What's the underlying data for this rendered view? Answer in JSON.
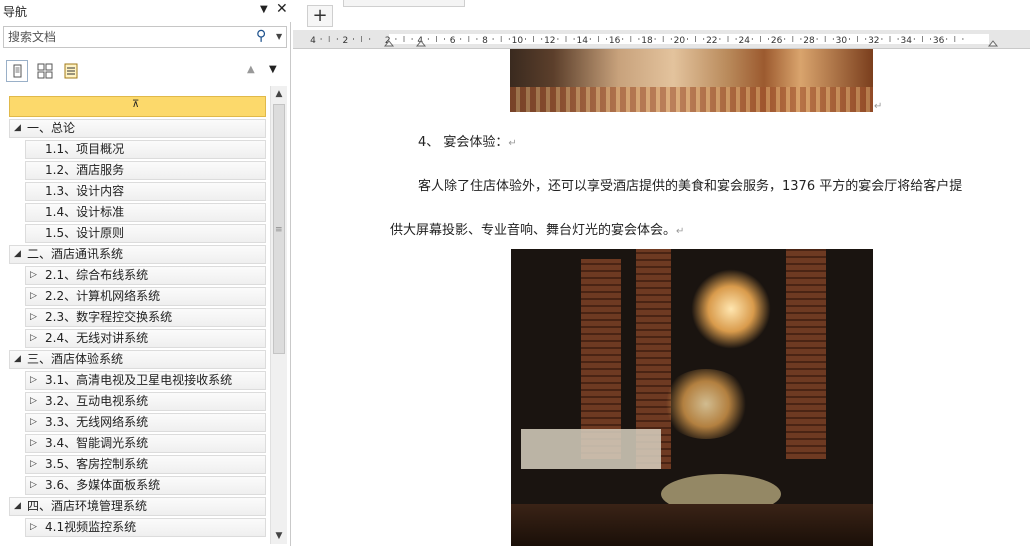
{
  "nav": {
    "title": "导航",
    "search_placeholder": "搜索文档",
    "icons": {
      "dropdown": "triangle-down-icon",
      "close": "close-icon",
      "search": "magnifier-icon"
    },
    "tree": [
      {
        "label": "一、总论",
        "level": 1,
        "expanded": true
      },
      {
        "label": "1.1、项目概况",
        "level": 2
      },
      {
        "label": "1.2、酒店服务",
        "level": 2
      },
      {
        "label": "1.3、设计内容",
        "level": 2
      },
      {
        "label": "1.4、设计标准",
        "level": 2
      },
      {
        "label": "1.5、设计原则",
        "level": 2
      },
      {
        "label": "二、酒店通讯系统",
        "level": 1,
        "expanded": true
      },
      {
        "label": "2.1、综合布线系统",
        "level": 2,
        "collapsed": true
      },
      {
        "label": "2.2、计算机网络系统",
        "level": 2,
        "collapsed": true
      },
      {
        "label": "2.3、数字程控交换系统",
        "level": 2,
        "collapsed": true
      },
      {
        "label": "2.4、无线对讲系统",
        "level": 2,
        "collapsed": true
      },
      {
        "label": "三、酒店体验系统",
        "level": 1,
        "expanded": true
      },
      {
        "label": "3.1、高清电视及卫星电视接收系统",
        "level": 2,
        "collapsed": true
      },
      {
        "label": "3.2、互动电视系统",
        "level": 2,
        "collapsed": true
      },
      {
        "label": "3.3、无线网络系统",
        "level": 2,
        "collapsed": true
      },
      {
        "label": "3.4、智能调光系统",
        "level": 2,
        "collapsed": true
      },
      {
        "label": "3.5、客房控制系统",
        "level": 2,
        "collapsed": true
      },
      {
        "label": "3.6、多媒体面板系统",
        "level": 2,
        "collapsed": true
      },
      {
        "label": "四、酒店环境管理系统",
        "level": 1,
        "expanded": true
      },
      {
        "label": "4.1视频监控系统",
        "level": 2,
        "collapsed": true
      }
    ]
  },
  "ruler": {
    "labels": [
      "4",
      "2",
      "2",
      "4",
      "6",
      "8",
      "10",
      "12",
      "14",
      "16",
      "18",
      "20",
      "22",
      "24",
      "26",
      "28",
      "30",
      "32",
      "34",
      "36"
    ]
  },
  "document": {
    "heading": "4、 宴会体验：",
    "body_line1": "客人除了住店体验外，还可以享受酒店提供的美食和宴会服务，1376 平方的宴会厅将给客户提",
    "body_line2": "供大屏幕投影、专业音响、舞台灯光的宴会体会。",
    "new_tab_label": "+"
  },
  "colors": {
    "collapse_bar": "#fcd96b",
    "tree_border": "#dcdcdc"
  }
}
